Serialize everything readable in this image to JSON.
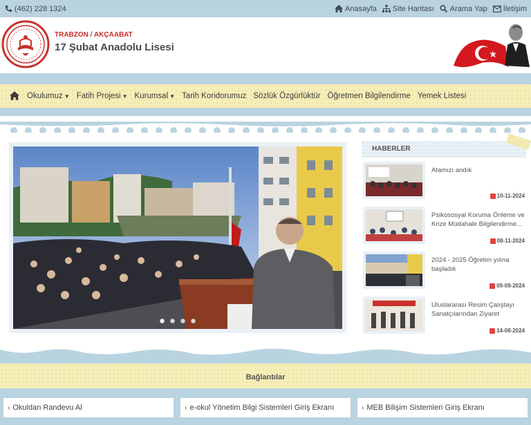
{
  "topbar": {
    "phone": "(462) 228 1324",
    "links": [
      {
        "label": "Anasayfa",
        "icon": "home-icon"
      },
      {
        "label": "Site Haritası",
        "icon": "sitemap-icon"
      },
      {
        "label": "Arama Yap",
        "icon": "search-icon"
      },
      {
        "label": "İletişim",
        "icon": "mail-icon"
      }
    ]
  },
  "header": {
    "region": "TRABZON / AKÇAABAT",
    "school_name": "17 Şubat Anadolu Lisesi"
  },
  "nav": {
    "items": [
      {
        "label": "Okulumuz",
        "dropdown": true
      },
      {
        "label": "Fatih Projesi",
        "dropdown": true
      },
      {
        "label": "Kurumsal",
        "dropdown": true
      },
      {
        "label": "Tarih Koridorumuz",
        "dropdown": false
      },
      {
        "label": "Sözlük Özgürlüktür",
        "dropdown": false
      },
      {
        "label": "Öğretmen Bilgilendirme",
        "dropdown": false
      },
      {
        "label": "Yemek Listesi",
        "dropdown": false
      }
    ]
  },
  "slider": {
    "slide_count": 4,
    "active_index": 0
  },
  "news": {
    "heading": "HABERLER",
    "items": [
      {
        "title": "Atamızı andık",
        "date": "10-11-2024"
      },
      {
        "title": "Psikososyal Koruma Önleme ve Krize Müdahale Bilgilendirme...",
        "date": "08-11-2024"
      },
      {
        "title": "2024 - 2025 Öğretim yılına başladık",
        "date": "09-09-2024"
      },
      {
        "title": "Uluslararası Resim Çalıştayı Sanatçılarından Ziyaret",
        "date": "14-08-2024"
      }
    ]
  },
  "links": {
    "heading": "Bağlantılar",
    "items": [
      {
        "label": "Okuldan Randevu Al"
      },
      {
        "label": "e-okul Yönetim Bilgi Sistemleri Giriş Ekranı"
      },
      {
        "label": "MEB Bilişim Sistemleri Giriş Ekranı"
      }
    ]
  },
  "colors": {
    "page_bg": "#b9d3e0",
    "accent_red": "#c9302c",
    "nav_bg": "#f6eeb8"
  }
}
